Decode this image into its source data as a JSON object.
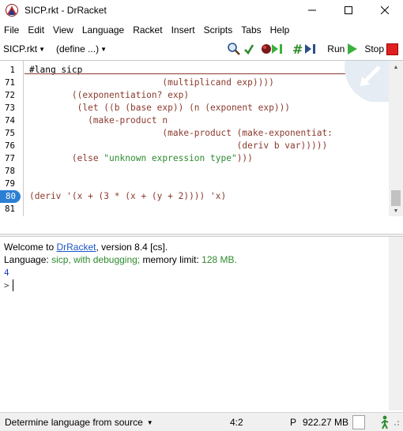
{
  "window": {
    "title": "SICP.rkt - DrRacket",
    "controls": [
      "minimize-icon",
      "maximize-icon",
      "close-icon"
    ]
  },
  "menu": [
    "File",
    "Edit",
    "View",
    "Language",
    "Racket",
    "Insert",
    "Scripts",
    "Tabs",
    "Help"
  ],
  "toolbar": {
    "file_dropdown": "SICP.rkt",
    "define_dropdown": "(define ...)",
    "run_label": "Run",
    "stop_label": "Stop",
    "colors": {
      "run": "#3cb03c",
      "stop": "#e02020",
      "check_syntax": "#2e8b2e"
    }
  },
  "editor": {
    "lines": [
      {
        "num": "1",
        "text": "#lang sicp",
        "kind": "lang"
      },
      {
        "num": "71",
        "text": "                         (multiplicand exp))))",
        "kind": "code"
      },
      {
        "num": "72",
        "text": "        ((exponentiation? exp)",
        "kind": "code"
      },
      {
        "num": "73",
        "text": "         (let ((b (base exp)) (n (exponent exp)))",
        "kind": "code"
      },
      {
        "num": "74",
        "text": "           (make-product n",
        "kind": "code"
      },
      {
        "num": "75",
        "text": "                         (make-product (make-exponentiat:",
        "kind": "code"
      },
      {
        "num": "76",
        "text": "                                       (deriv b var)))))",
        "kind": "code"
      },
      {
        "num": "77",
        "text": "        (else \"unknown expression type\")))",
        "kind": "else"
      },
      {
        "num": "78",
        "text": "",
        "kind": "code"
      },
      {
        "num": "79",
        "text": "",
        "kind": "code"
      },
      {
        "num": "80",
        "text": "(deriv '(x + (3 * (x + (y + 2)))) 'x)",
        "kind": "code",
        "active": true
      },
      {
        "num": "81",
        "text": "",
        "kind": "code"
      }
    ]
  },
  "repl": {
    "welcome_prefix": "Welcome to ",
    "welcome_link": "DrRacket",
    "welcome_suffix": ", version 8.4 [cs].",
    "language_label": "Language: ",
    "language_value": "sicp, with debugging;",
    "memory_label": " memory limit: ",
    "memory_value": "128 MB.",
    "result": "4",
    "prompt": ">"
  },
  "status": {
    "language_mode": "Determine language from source",
    "position": "4:2",
    "p_indicator": "P",
    "memory": "922.27 MB"
  }
}
